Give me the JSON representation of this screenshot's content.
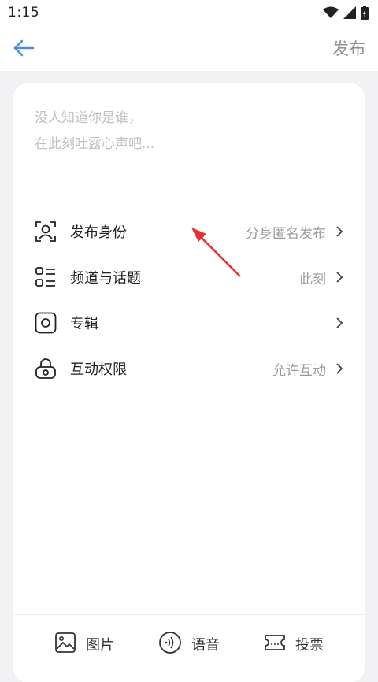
{
  "status_bar": {
    "time": "1:15",
    "icons": [
      "wifi-icon",
      "signal-icon",
      "battery-icon"
    ]
  },
  "header": {
    "back_icon": "arrow-left-icon",
    "publish_label": "发布",
    "accent_color": "#4a90e2"
  },
  "compose": {
    "placeholder_line1": "没人知道你是谁，",
    "placeholder_line2": "在此刻吐露心声吧..."
  },
  "options": [
    {
      "icon": "person-frame-icon",
      "label": "发布身份",
      "value": "分身匿名发布"
    },
    {
      "icon": "grid-list-icon",
      "label": "频道与话题",
      "value": "此刻"
    },
    {
      "icon": "album-icon",
      "label": "专辑",
      "value": ""
    },
    {
      "icon": "lock-icon",
      "label": "互动权限",
      "value": "允许互动"
    }
  ],
  "toolbar": [
    {
      "icon": "image-icon",
      "label": "图片"
    },
    {
      "icon": "voice-icon",
      "label": "语音"
    },
    {
      "icon": "vote-icon",
      "label": "投票"
    }
  ],
  "annotation": {
    "type": "red-arrow",
    "color": "#e8302e"
  }
}
